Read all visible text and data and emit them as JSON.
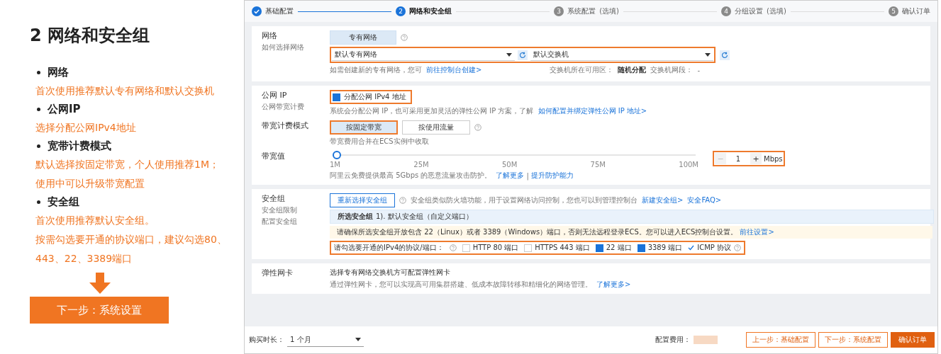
{
  "guide": {
    "title": "2 网络和安全组",
    "items": [
      {
        "heading": "网络",
        "notes": [
          "首次使用推荐默认专有网络和默认交换机"
        ]
      },
      {
        "heading": "公网IP",
        "notes": [
          "选择分配公网IPv4地址"
        ]
      },
      {
        "heading": "宽带计费模式",
        "notes": [
          "默认选择按固定带宽，个人使用推荐1M；",
          "使用中可以升级带宽配置"
        ]
      },
      {
        "heading": "安全组",
        "notes": [
          "首次使用推荐默认安全组。",
          "按需勾选要开通的协议端口，建议勾选80、",
          "443、22、3389端口"
        ]
      }
    ],
    "next_button": "下一步：系统设置"
  },
  "console": {
    "steps": [
      {
        "label": "基础配置",
        "completed": true,
        "selected": false
      },
      {
        "number": "2",
        "label": "网络和安全组",
        "completed": false,
        "selected": true
      },
      {
        "number": "3",
        "label": "系统配置",
        "hint": "(选填)",
        "completed": false,
        "selected": false
      },
      {
        "number": "4",
        "label": "分组设置",
        "hint": "(选填)",
        "completed": false,
        "selected": false
      },
      {
        "number": "5",
        "label": "确认订单",
        "completed": false,
        "selected": false
      }
    ],
    "network": {
      "label": "网络",
      "sublabel": "如何选择网络",
      "type_tabs": [
        {
          "label": "专有网络",
          "selected": true
        }
      ],
      "vpc_select": "默认专有网络",
      "vswitch_select": "默认交换机",
      "highlighted": true,
      "vpc_hint": "如需创建新的专有网络，您可",
      "vpc_link": "前往控制台创建>",
      "zone_label": "交换机所在可用区：",
      "zone_value": "随机分配",
      "cidr_label": "交换机网段：",
      "cidr_value": "-"
    },
    "public_ip": {
      "label": "公网 IP",
      "sublabel": "公网带宽计费",
      "checkbox": {
        "label": "分配公网 IPv4 地址",
        "checked": true,
        "highlighted": true
      },
      "desc": "系统会分配公网 IP，也可采用更加灵活的弹性公网 IP 方案，了解",
      "link": "如何配置并绑定弹性公网 IP 地址>"
    },
    "billing": {
      "label": "带宽计费模式",
      "options": [
        {
          "label": "按固定带宽",
          "selected": true,
          "highlighted": true
        },
        {
          "label": "按使用流量",
          "selected": false,
          "highlighted": false
        }
      ],
      "hint": "带宽费用合并在ECS实例中收取"
    },
    "bandwidth": {
      "label": "带宽值",
      "level": 0,
      "ticks": [
        "1M",
        "25M",
        "50M",
        "75M",
        "100M"
      ],
      "value": "1",
      "minus": "−",
      "plus": "+",
      "unit": "Mbps",
      "highlighted": true,
      "desc": "阿里云免费提供最高 5Gbps 的恶意流量攻击防护。",
      "link1": "了解更多",
      "separator": "|",
      "link2": "提升防护能力"
    },
    "security": {
      "label": "安全组",
      "sublabels": [
        "安全组限制",
        "配置安全组"
      ],
      "reselect_button": "重新选择安全组",
      "desc": "安全组类似防火墙功能，用于设置网络访问控制，您也可以到管理控制台",
      "link1": "新建安全组>",
      "link2": "安全FAQ>",
      "selected_label": "所选安全组",
      "selected_value": "1). 默认安全组（自定义端口）",
      "warning": "请确保所选安全组开放包含 22（Linux）或者 3389（Windows）端口，否则无法远程登录ECS。您可以进入ECS控制台设置。",
      "warning_link": "前往设置>",
      "ports_label": "请勾选要开通的IPv4的协议/端口：",
      "ports_highlighted": true,
      "ports": [
        {
          "kind": "checkbox",
          "label": "HTTP 80 端口",
          "checked": false
        },
        {
          "kind": "checkbox",
          "label": "HTTPS 443 端口",
          "checked": false
        },
        {
          "kind": "checkbox",
          "label": "22 端口",
          "checked": true
        },
        {
          "kind": "checkbox",
          "label": "3389 端口",
          "checked": true
        },
        {
          "kind": "tick",
          "label": "ICMP 协议",
          "checked": true
        }
      ]
    },
    "eni": {
      "label": "弹性网卡",
      "line1": "选择专有网络交换机方可配置弹性网卡",
      "line2": "通过弹性网卡，您可以实现高可用集群搭建、低成本故障转移和精细化的网络管理。",
      "link": "了解更多>"
    },
    "footer": {
      "duration_label": "购买时长：",
      "duration_value": "1 个月",
      "fee_label": "配置费用：",
      "buttons": [
        {
          "kind": "outline",
          "label": "上一步：基础配置"
        },
        {
          "kind": "outline",
          "label": "下一步：系统配置"
        },
        {
          "kind": "primary",
          "label": "确认订单"
        }
      ]
    }
  }
}
